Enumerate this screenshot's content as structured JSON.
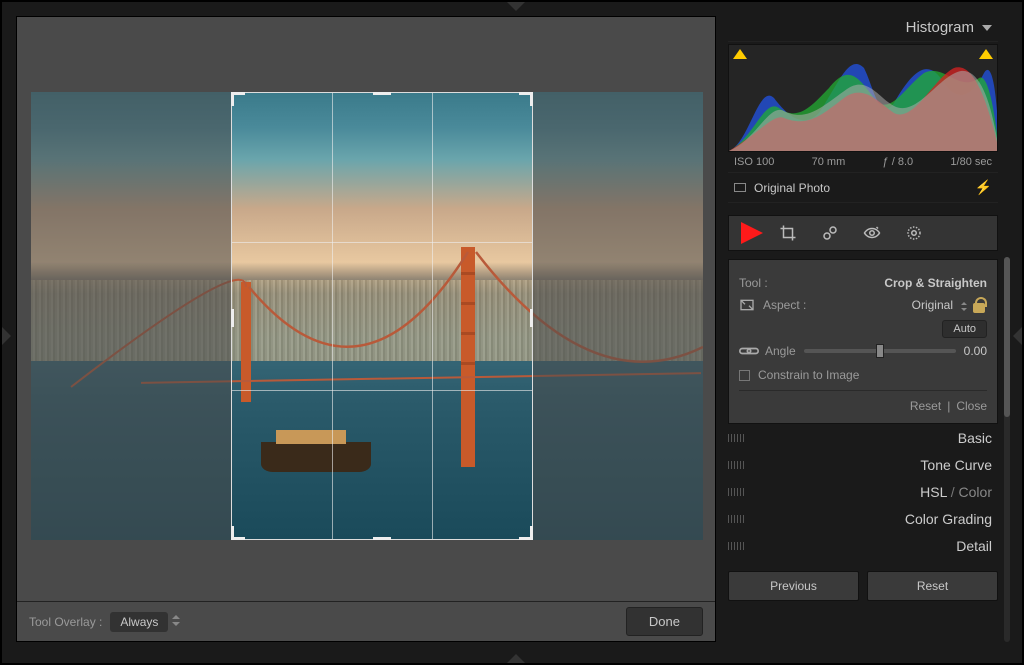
{
  "histogram_label": "Histogram",
  "meta": {
    "iso": "ISO 100",
    "focal": "70 mm",
    "aperture": "ƒ / 8.0",
    "shutter": "1/80 sec"
  },
  "original_photo": "Original Photo",
  "tool_row": {
    "label": "Tool :",
    "value": "Crop & Straighten"
  },
  "aspect": {
    "label": "Aspect :",
    "value": "Original"
  },
  "auto": "Auto",
  "angle": {
    "label": "Angle",
    "value": "0.00"
  },
  "constrain": "Constrain to Image",
  "reset": "Reset",
  "close": "Close",
  "panels": {
    "basic": "Basic",
    "tone": "Tone Curve",
    "hsl": "HSL",
    "color": "Color",
    "grading": "Color Grading",
    "detail": "Detail"
  },
  "prev": "Previous",
  "reset2": "Reset",
  "bottom": {
    "tool_overlay": "Tool Overlay :",
    "always": "Always",
    "done": "Done"
  }
}
